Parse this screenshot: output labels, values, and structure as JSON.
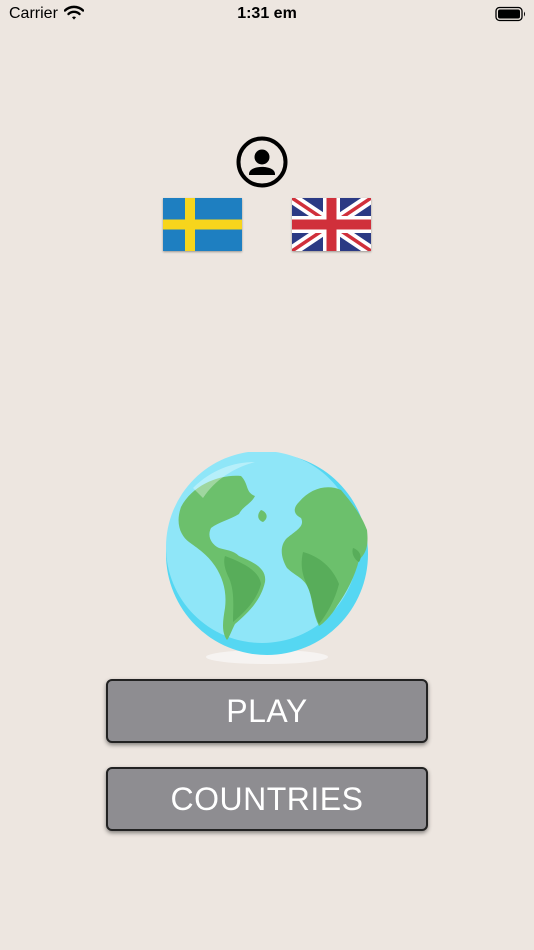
{
  "status_bar": {
    "carrier": "Carrier",
    "time": "1:31 em",
    "wifi_icon": "wifi-icon",
    "battery_icon": "battery-icon"
  },
  "profile": {
    "icon": "user-circle-icon"
  },
  "languages": [
    {
      "name": "Swedish",
      "icon": "sweden-flag-icon"
    },
    {
      "name": "English",
      "icon": "uk-flag-icon"
    }
  ],
  "hero": {
    "icon": "globe-icon"
  },
  "buttons": {
    "play_label": "PLAY",
    "countries_label": "COUNTRIES"
  },
  "colors": {
    "background": "#ede6e0",
    "button": "#8e8d91",
    "button_text": "#ffffff",
    "sweden_blue": "#1e7fc1",
    "sweden_yellow": "#f7d51c",
    "uk_blue": "#2b3a84",
    "uk_red": "#d0303b"
  }
}
